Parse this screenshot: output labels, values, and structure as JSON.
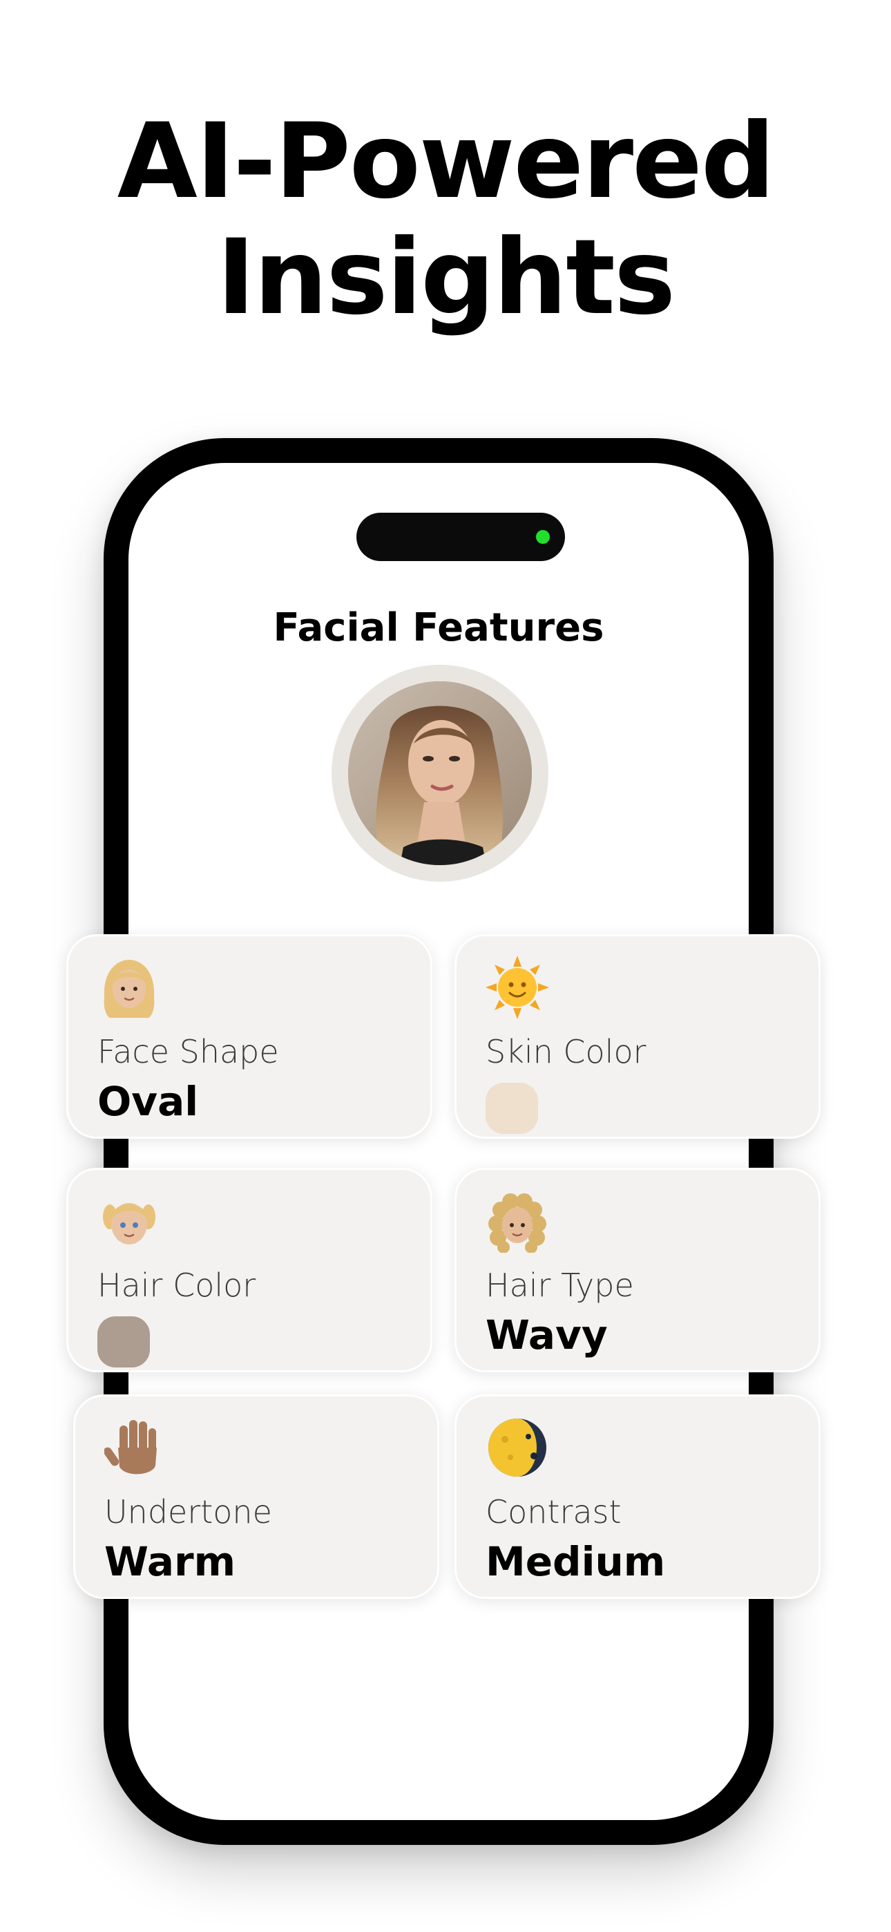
{
  "headline": {
    "line1": "AI-Powered",
    "line2": "Insights"
  },
  "screen": {
    "title": "Facial Features"
  },
  "colors": {
    "island_indicator": "#22e02a",
    "card_background": "#f3f2f0",
    "skin_swatch": "#efdfcd",
    "hair_swatch": "#ad9c90"
  },
  "features": {
    "face_shape": {
      "icon": "woman-blonde-icon",
      "label": "Face Shape",
      "value": "Oval"
    },
    "skin_color": {
      "icon": "sun-face-icon",
      "label": "Skin Color",
      "swatch": "#efdfcd"
    },
    "hair_color": {
      "icon": "girl-pigtails-icon",
      "label": "Hair Color",
      "swatch": "#ad9c90"
    },
    "hair_type": {
      "icon": "curly-hair-icon",
      "label": "Hair Type",
      "value": "Wavy"
    },
    "undertone": {
      "icon": "raised-hand-icon",
      "label": "Undertone",
      "value": "Warm"
    },
    "contrast": {
      "icon": "moon-phase-icon",
      "label": "Contrast",
      "value": "Medium"
    }
  }
}
